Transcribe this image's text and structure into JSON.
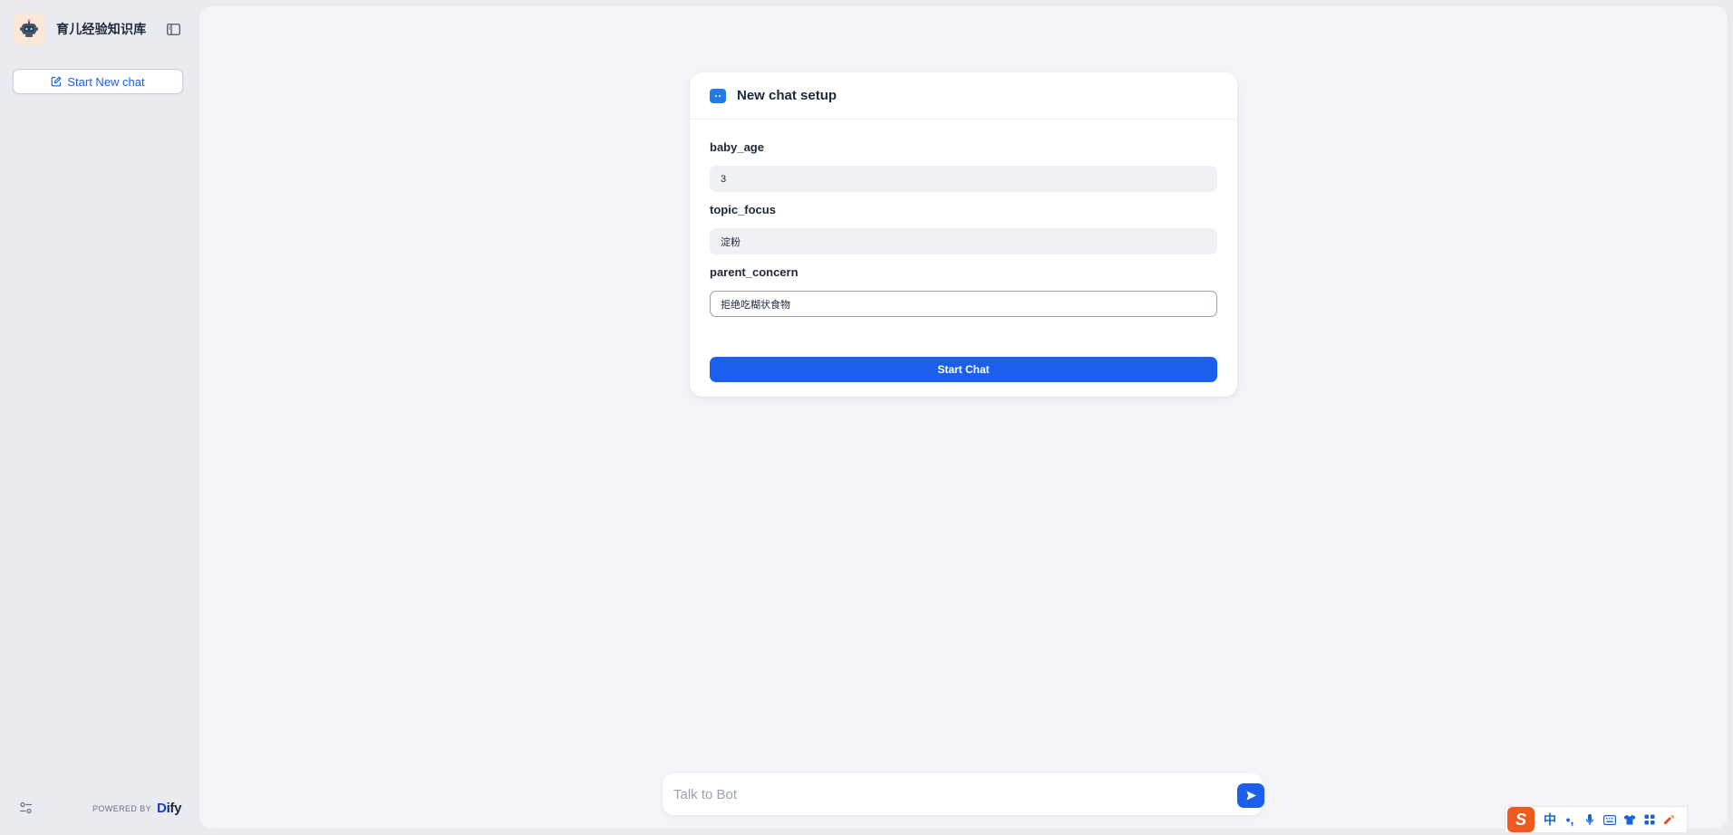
{
  "sidebar": {
    "app_title": "育儿经验知识库",
    "new_chat_label": "Start New chat",
    "powered_by_label": "POWERED BY",
    "powered_by_brand_d": "D",
    "powered_by_brand_rest": "ify"
  },
  "setup_card": {
    "title": "New chat setup",
    "fields": [
      {
        "label": "baby_age",
        "value": "3"
      },
      {
        "label": "topic_focus",
        "value": "淀粉"
      },
      {
        "label": "parent_concern",
        "value": "拒绝吃糊状食物"
      }
    ],
    "start_button_label": "Start Chat"
  },
  "composer": {
    "placeholder": "Talk to Bot"
  },
  "ime": {
    "logo": "S",
    "mode": "中",
    "punct": "•,"
  },
  "colors": {
    "accent": "#1b5fec",
    "sidebar_bg": "#e9ebf0",
    "main_bg": "#f3f4f7"
  },
  "icons": [
    "robot-avatar-icon",
    "sidebar-toggle-icon",
    "edit-icon",
    "chat-bubble-icon",
    "send-icon",
    "settings-sliders-icon",
    "microphone-icon",
    "keyboard-icon",
    "shirt-icon",
    "grid-icon",
    "tool-icon"
  ]
}
